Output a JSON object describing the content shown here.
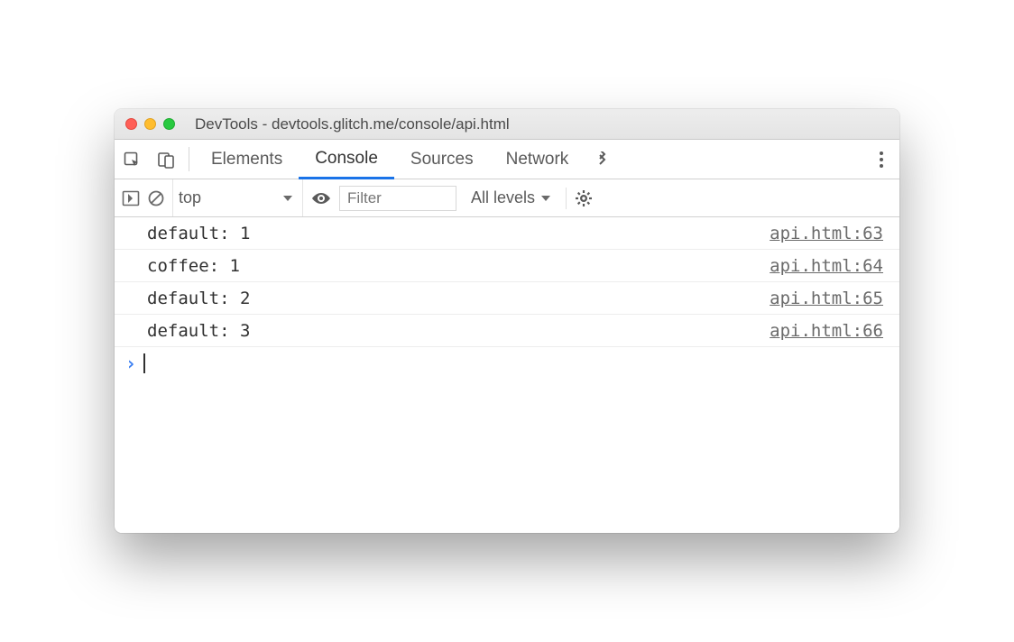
{
  "window": {
    "title": "DevTools - devtools.glitch.me/console/api.html"
  },
  "tabs": {
    "items": [
      "Elements",
      "Console",
      "Sources",
      "Network"
    ],
    "active_index": 1
  },
  "toolbar": {
    "context": "top",
    "filter_placeholder": "Filter",
    "levels": "All levels"
  },
  "console": {
    "messages": [
      {
        "text": "default: 1",
        "source": "api.html:63"
      },
      {
        "text": "coffee: 1",
        "source": "api.html:64"
      },
      {
        "text": "default: 2",
        "source": "api.html:65"
      },
      {
        "text": "default: 3",
        "source": "api.html:66"
      }
    ]
  }
}
